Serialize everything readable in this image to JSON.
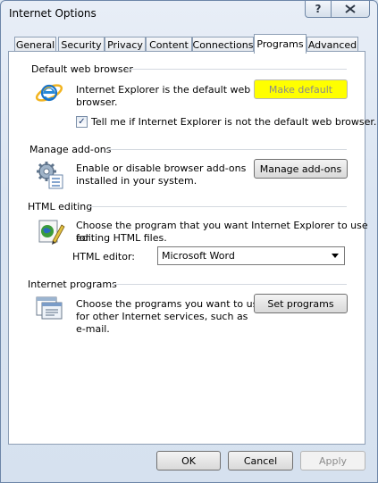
{
  "window": {
    "title": "Internet Options",
    "help_label": "?",
    "close_label": "x"
  },
  "tabs": [
    {
      "label": "General"
    },
    {
      "label": "Security"
    },
    {
      "label": "Privacy"
    },
    {
      "label": "Content"
    },
    {
      "label": "Connections"
    },
    {
      "label": "Programs"
    },
    {
      "label": "Advanced"
    }
  ],
  "default_browser": {
    "heading": "Default web browser",
    "line1": "Internet Explorer is the default web",
    "line2": "browser.",
    "button": "Make default",
    "checkbox_label": "Tell me if Internet Explorer is not the default web browser.",
    "checkbox_mark": "✓",
    "highlight_color": "#ffff00"
  },
  "addons": {
    "heading": "Manage add-ons",
    "line1": "Enable or disable browser add-ons",
    "line2": "installed in your system.",
    "button": "Manage add-ons"
  },
  "html_editing": {
    "heading": "HTML editing",
    "line1": "Choose the program that you want Internet Explorer to use for",
    "line2": "editing HTML files.",
    "editor_label": "HTML editor:",
    "editor_value": "Microsoft Word"
  },
  "internet_programs": {
    "heading": "Internet programs",
    "line1": "Choose the programs you want to use",
    "line2": "for other Internet services, such as",
    "line3": "e-mail.",
    "button": "Set programs"
  },
  "footer": {
    "ok": "OK",
    "cancel": "Cancel",
    "apply": "Apply"
  },
  "icons": {
    "ie": "internet-explorer-icon",
    "addons": "addons-gear-icon",
    "html": "html-editor-icon",
    "programs": "programs-icon"
  }
}
